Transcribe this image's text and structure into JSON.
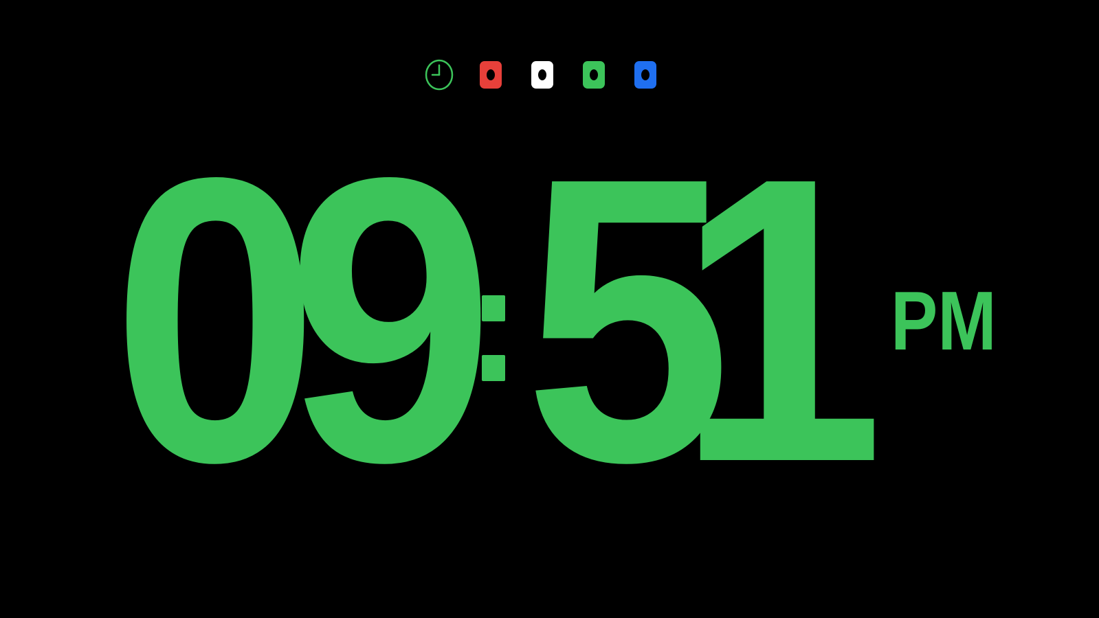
{
  "toolbar": {
    "buttons": [
      {
        "name": "clock-mode-button",
        "icon": "clock-icon",
        "color": "#3cc45a"
      },
      {
        "name": "color-red-button",
        "icon": "red-swatch-icon",
        "color": "#e8403a"
      },
      {
        "name": "color-white-button",
        "icon": "white-swatch-icon",
        "color": "#ffffff"
      },
      {
        "name": "color-green-button",
        "icon": "green-swatch-icon",
        "color": "#3cc45a"
      },
      {
        "name": "color-blue-button",
        "icon": "blue-swatch-icon",
        "color": "#1f6ff0"
      }
    ]
  },
  "clock": {
    "hour_tens": "0",
    "hour_ones": "9",
    "minute_tens": "5",
    "minute_ones": "1",
    "period": "PM",
    "display_color": "#3cc45a"
  }
}
